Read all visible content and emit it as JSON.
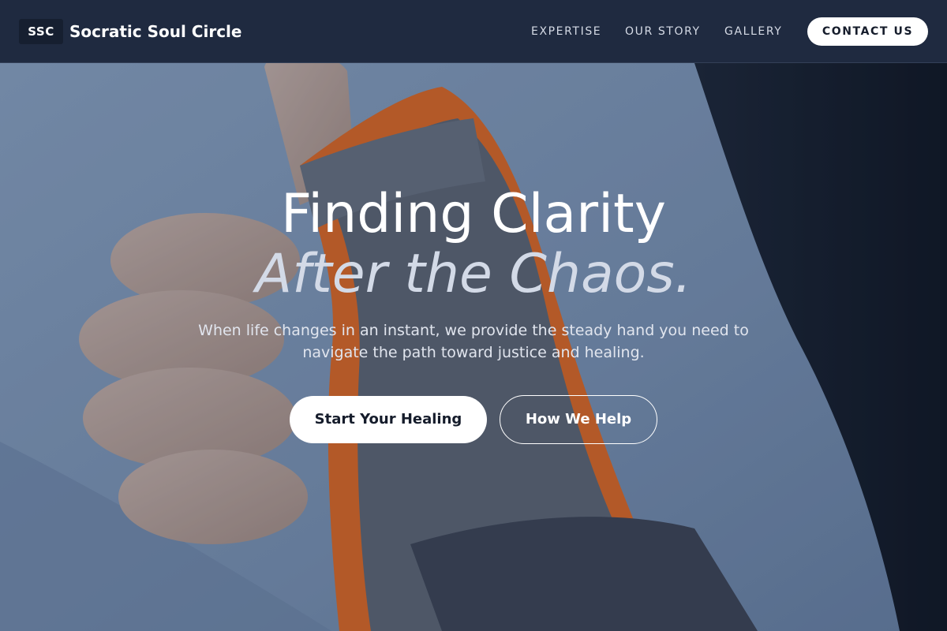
{
  "nav": {
    "logo_badge": "SSC",
    "brand_name": "Socratic Soul Circle",
    "links": [
      {
        "label": "EXPERTISE"
      },
      {
        "label": "OUR STORY"
      },
      {
        "label": "GALLERY"
      }
    ],
    "contact_button": "CONTACT US"
  },
  "hero": {
    "title_line1": "Finding Clarity",
    "title_line2": "After the Chaos.",
    "subtitle": "When life changes in an instant, we provide the steady hand you need to navigate the path toward justice and healing.",
    "primary_button": "Start Your Healing",
    "secondary_button": "How We Help",
    "background_image": "hand-wrist-brace-thumbs-up-photo"
  },
  "colors": {
    "nav_background": "#1f2a40",
    "button_primary_background": "#ffffff",
    "button_text_dark": "#151c2b",
    "brace_orange": "#e06a26",
    "shirt_blue": "#7d96b8"
  }
}
